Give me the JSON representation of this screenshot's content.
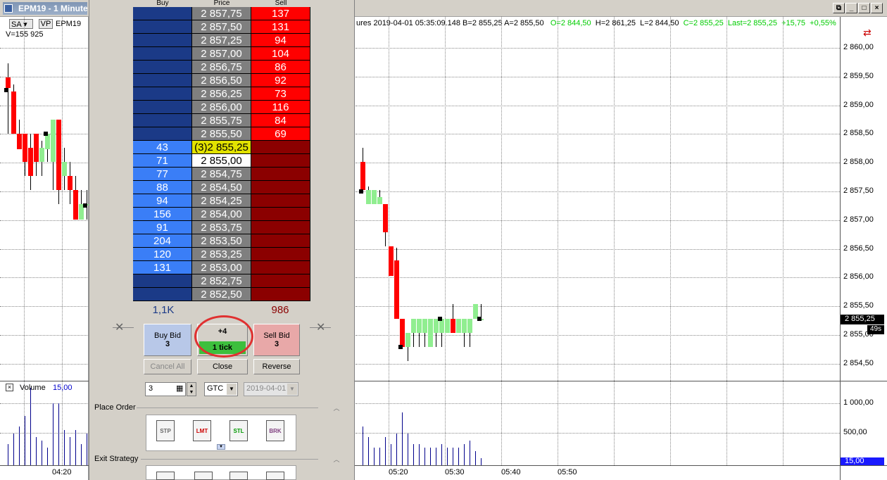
{
  "window": {
    "title": "EPM19 - 1 Minute",
    "min": "_",
    "max": "□",
    "close": "×",
    "restore": "⧉"
  },
  "toolbar": {
    "sa": "SA",
    "vp": "VP",
    "symbol": "EPM19",
    "volume": "V=155 925"
  },
  "quote": {
    "text": "ures  2019-04-01  05:35:09.148  B=2 855,25  A=2 855,50",
    "o": "O=2 844,50",
    "h": "H=2 861,25",
    "l": "L=2 844,50",
    "c": "C=2 855,25",
    "last": "Last=2 855,25",
    "chg": "+15,75",
    "pct": "+0,55%"
  },
  "price_axis": [
    "2 860,00",
    "2 859,50",
    "2 859,00",
    "2 858,50",
    "2 858,00",
    "2 857,50",
    "2 857,00",
    "2 856,50",
    "2 856,00",
    "2 855,50",
    "2 855,00",
    "2 854,50"
  ],
  "last_tag": "2 855,25",
  "countdown": "49s",
  "volume_axis": [
    "1 000,00",
    "500,00"
  ],
  "volume_tag": "15,00",
  "volume_label": "Volume",
  "volume_value": "15,00",
  "time_axis_left": [
    "04:20"
  ],
  "time_axis_right": [
    "05:20",
    "05:30",
    "05:40",
    "05:50"
  ],
  "ladder": {
    "headers": {
      "buy": "Buy",
      "price": "Price",
      "sell": "Sell"
    },
    "rows": [
      {
        "buy": "",
        "price": "2 857,75",
        "sell": "137"
      },
      {
        "buy": "",
        "price": "2 857,50",
        "sell": "131"
      },
      {
        "buy": "",
        "price": "2 857,25",
        "sell": "94"
      },
      {
        "buy": "",
        "price": "2 857,00",
        "sell": "104"
      },
      {
        "buy": "",
        "price": "2 856,75",
        "sell": "86"
      },
      {
        "buy": "",
        "price": "2 856,50",
        "sell": "92"
      },
      {
        "buy": "",
        "price": "2 856,25",
        "sell": "73"
      },
      {
        "buy": "",
        "price": "2 856,00",
        "sell": "116"
      },
      {
        "buy": "",
        "price": "2 855,75",
        "sell": "84"
      },
      {
        "buy": "",
        "price": "2 855,50",
        "sell": "69"
      },
      {
        "buy": "43",
        "price": "(3)2 855,25",
        "sell": ""
      },
      {
        "buy": "71",
        "price": "2 855,00",
        "sell": ""
      },
      {
        "buy": "77",
        "price": "2 854,75",
        "sell": ""
      },
      {
        "buy": "88",
        "price": "2 854,50",
        "sell": ""
      },
      {
        "buy": "94",
        "price": "2 854,25",
        "sell": ""
      },
      {
        "buy": "156",
        "price": "2 854,00",
        "sell": ""
      },
      {
        "buy": "91",
        "price": "2 853,75",
        "sell": ""
      },
      {
        "buy": "204",
        "price": "2 853,50",
        "sell": ""
      },
      {
        "buy": "120",
        "price": "2 853,25",
        "sell": ""
      },
      {
        "buy": "131",
        "price": "2 853,00",
        "sell": ""
      },
      {
        "buy": "",
        "price": "2 852,75",
        "sell": ""
      },
      {
        "buy": "",
        "price": "2 852,50",
        "sell": ""
      }
    ],
    "total_buy": "1,1K",
    "total_sell": "986"
  },
  "order": {
    "buy_bid": "Buy Bid",
    "buy_qty": "3",
    "offset": "+4",
    "tick": "1 tick",
    "sell_bid": "Sell Bid",
    "sell_qty": "3",
    "cancel_all": "Cancel All",
    "close": "Close",
    "reverse": "Reverse",
    "qty": "3",
    "tif": "GTC",
    "date": "2019-04-01"
  },
  "sections": {
    "place_order": "Place Order",
    "exit_strategy": "Exit Strategy"
  },
  "order_types": [
    "STP",
    "LMT",
    "STL",
    "BRK"
  ],
  "colors": {
    "bid_dark": "#1b3a87",
    "bid_light": "#3a7ef7",
    "ask_light": "#ff0000",
    "ask_dark": "#8b0000",
    "price_gray": "#7f7f7f",
    "last_yellow": "#e2e200",
    "up": "#90ee90",
    "down": "#ff0000"
  }
}
